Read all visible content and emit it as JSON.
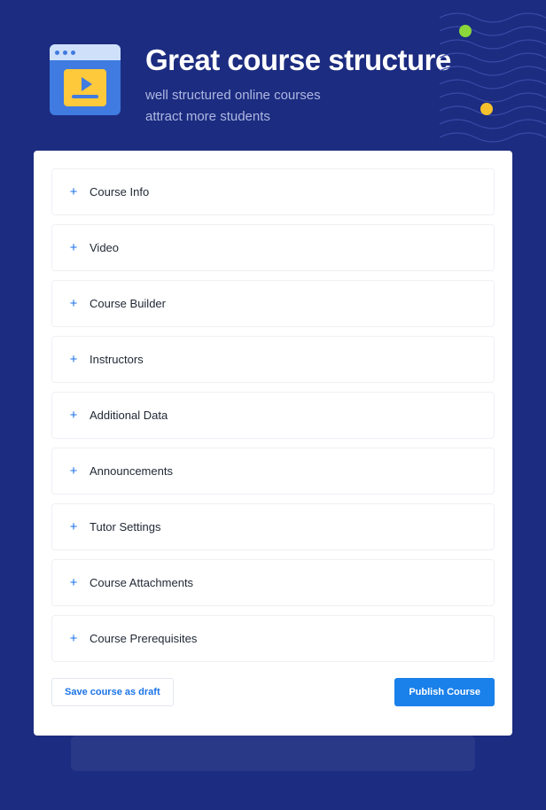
{
  "header": {
    "title": "Great course structure",
    "subtitle_line1": "well structured online courses",
    "subtitle_line2": "attract more students"
  },
  "accordion": {
    "items": [
      {
        "label": "Course Info"
      },
      {
        "label": "Video"
      },
      {
        "label": "Course Builder"
      },
      {
        "label": "Instructors"
      },
      {
        "label": "Additional Data"
      },
      {
        "label": "Announcements"
      },
      {
        "label": "Tutor Settings"
      },
      {
        "label": "Course Attachments"
      },
      {
        "label": "Course Prerequisites"
      }
    ]
  },
  "actions": {
    "draft_label": "Save course as draft",
    "publish_label": "Publish Course"
  }
}
